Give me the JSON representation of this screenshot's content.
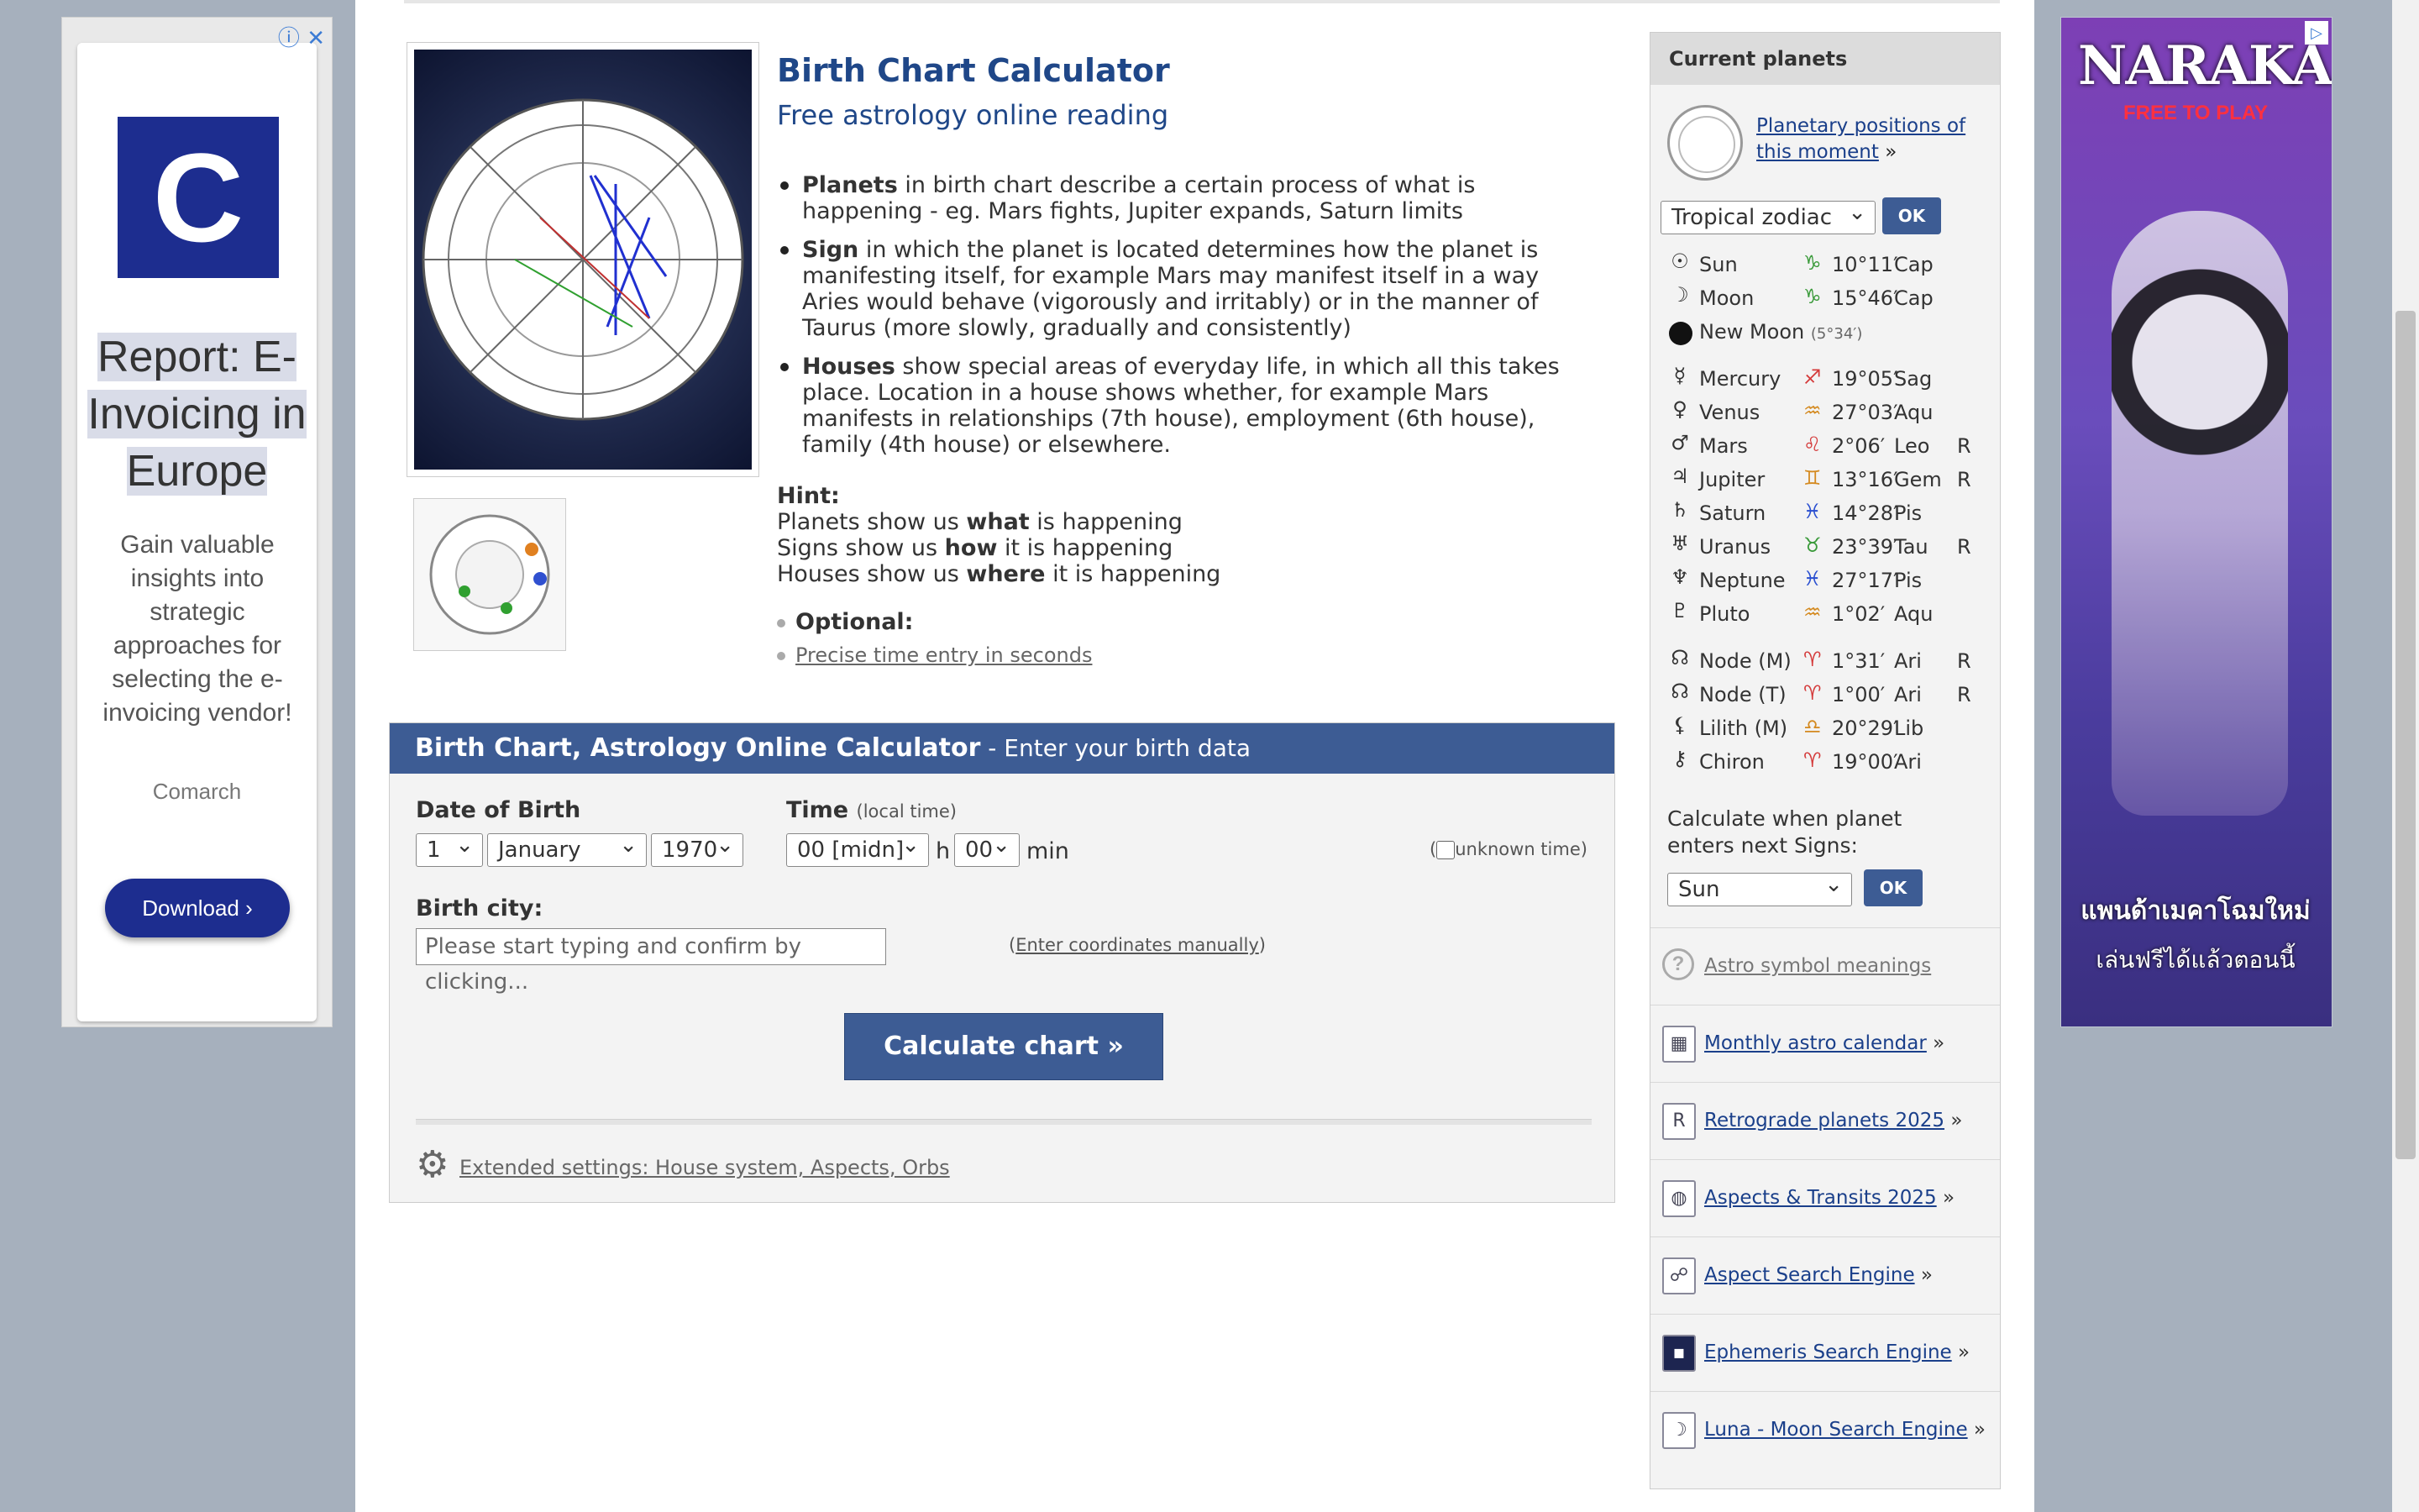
{
  "ad_left": {
    "logo_letter": "C",
    "headline": "Report: E-Invoicing in Europe",
    "text": "Gain valuable insights into strategic approaches for selecting the e-invoicing vendor!",
    "brand": "Comarch",
    "button": "Download ›",
    "info_icon": "info-icon",
    "close_icon": "close-icon"
  },
  "ad_right": {
    "title": "NARAKA",
    "subtitle": "FREE TO PLAY",
    "thai_line1": "แพนด้าเมคาโฉมใหม่",
    "thai_line2": "เล่นฟรีได้แล้วตอนนี้"
  },
  "hero": {
    "title": "Birth Chart Calculator",
    "subtitle": "Free astrology online reading",
    "bullets": [
      {
        "bold": "Planets",
        "text": " in birth chart describe a certain process of what is happening - eg. Mars fights, Jupiter expands, Saturn limits"
      },
      {
        "bold": "Sign",
        "text": " in which the planet is located determines how the planet is manifesting itself, for example Mars may manifest itself in a way Aries would behave (vigorously and irritably) or in the manner of Taurus (more slowly, gradually and consistently)"
      },
      {
        "bold": "Houses",
        "text": " show special areas of everyday life, in which all this takes place. Location in a house shows whether, for example Mars manifests in relationships (7th house), employment (6th house), family (4th house) or elsewhere."
      }
    ],
    "hint_label": "Hint:",
    "hint_lines": [
      {
        "pre": "Planets show us ",
        "bold": "what",
        "post": " is happening"
      },
      {
        "pre": "Signs show us ",
        "bold": "how",
        "post": " it is happening"
      },
      {
        "pre": "Houses show us ",
        "bold": "where",
        "post": " it is happening"
      }
    ],
    "optional_label": "Optional:",
    "precise_link": "Precise time entry in seconds"
  },
  "form": {
    "header_bold": "Birth Chart, Astrology Online Calculator",
    "header_rest": " - Enter your birth data",
    "dob_label": "Date of Birth",
    "day": "1",
    "month": "January",
    "year": "1970",
    "time_label": "Time",
    "time_hint": "(local time)",
    "hour": "00 [midn]",
    "h_unit": "h",
    "minute": "00",
    "min_unit": "min",
    "unknown_time": "unknown time",
    "city_label": "Birth city:",
    "city_placeholder": "Please start typing and confirm by clicking...",
    "manual_link": "Enter coordinates manually",
    "calc_button": "Calculate chart »",
    "extended_link": "Extended settings: House system, Aspects, Orbs"
  },
  "sidebar": {
    "header": "Current planets",
    "positions_link": "Planetary positions of this moment",
    "zodiac_select": "Tropical zodiac",
    "ok": "OK",
    "planets_a": [
      {
        "icon": "☉",
        "name": "Sun",
        "sign": "♑",
        "sign_color": "#3a9a3a",
        "deg": "10°11′",
        "zn": "Cap",
        "r": ""
      },
      {
        "icon": "☽",
        "name": "Moon",
        "sign": "♑",
        "sign_color": "#3a9a3a",
        "deg": "15°46′",
        "zn": "Cap",
        "r": ""
      }
    ],
    "new_moon": {
      "name": "New Moon",
      "deg": "(5°34′)"
    },
    "planets_b": [
      {
        "icon": "☿",
        "name": "Mercury",
        "sign": "♐",
        "sign_color": "#d43a3a",
        "deg": "19°05′",
        "zn": "Sag",
        "r": ""
      },
      {
        "icon": "♀",
        "name": "Venus",
        "sign": "♒",
        "sign_color": "#d48a20",
        "deg": "27°03′",
        "zn": "Aqu",
        "r": ""
      },
      {
        "icon": "♂",
        "name": "Mars",
        "sign": "♌",
        "sign_color": "#d43a3a",
        "deg": "2°06′",
        "zn": "Leo",
        "r": "R"
      },
      {
        "icon": "♃",
        "name": "Jupiter",
        "sign": "♊",
        "sign_color": "#d48a20",
        "deg": "13°16′",
        "zn": "Gem",
        "r": "R"
      },
      {
        "icon": "♄",
        "name": "Saturn",
        "sign": "♓",
        "sign_color": "#2a4fd0",
        "deg": "14°28′",
        "zn": "Pis",
        "r": ""
      },
      {
        "icon": "♅",
        "name": "Uranus",
        "sign": "♉",
        "sign_color": "#3a9a3a",
        "deg": "23°39′",
        "zn": "Tau",
        "r": "R"
      },
      {
        "icon": "♆",
        "name": "Neptune",
        "sign": "♓",
        "sign_color": "#2a4fd0",
        "deg": "27°17′",
        "zn": "Pis",
        "r": ""
      },
      {
        "icon": "♇",
        "name": "Pluto",
        "sign": "♒",
        "sign_color": "#d48a20",
        "deg": "1°02′",
        "zn": "Aqu",
        "r": ""
      }
    ],
    "planets_c": [
      {
        "icon": "☊",
        "name": "Node (M)",
        "sign": "♈",
        "sign_color": "#d43a3a",
        "deg": "1°31′",
        "zn": "Ari",
        "r": "R"
      },
      {
        "icon": "☊",
        "name": "Node (T)",
        "sign": "♈",
        "sign_color": "#d43a3a",
        "deg": "1°00′",
        "zn": "Ari",
        "r": "R"
      },
      {
        "icon": "⚸",
        "name": "Lilith (M)",
        "sign": "♎",
        "sign_color": "#d48a20",
        "deg": "20°29′",
        "zn": "Lib",
        "r": ""
      },
      {
        "icon": "⚷",
        "name": "Chiron",
        "sign": "♈",
        "sign_color": "#d43a3a",
        "deg": "19°00′",
        "zn": "Ari",
        "r": ""
      }
    ],
    "next_sign_text": "Calculate when planet enters next Signs:",
    "next_sign_select": "Sun",
    "links": [
      {
        "icon": "?",
        "label": "Astro symbol meanings",
        "suffix": ""
      },
      {
        "icon": "▦",
        "label": "Monthly astro calendar",
        "suffix": " »"
      },
      {
        "icon": "R",
        "label": "Retrograde planets 2025",
        "suffix": " »"
      },
      {
        "icon": "◍",
        "label": "Aspects & Transits 2025",
        "suffix": " »"
      },
      {
        "icon": "☍",
        "label": "Aspect Search Engine",
        "suffix": " »"
      },
      {
        "icon": "▪",
        "label": "Ephemeris Search Engine",
        "suffix": " »"
      },
      {
        "icon": "☽",
        "label": "Luna - Moon Search Engine",
        "suffix": " »"
      }
    ]
  }
}
